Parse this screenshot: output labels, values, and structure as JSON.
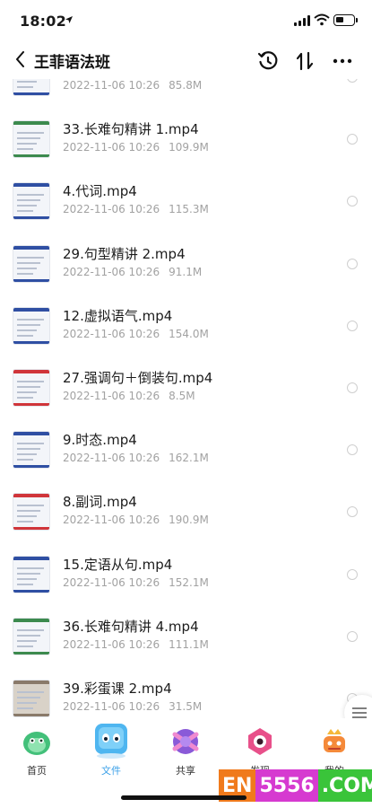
{
  "status_bar": {
    "time": "18:02"
  },
  "header": {
    "title": "王菲语法班"
  },
  "files": [
    {
      "name": "",
      "date": "2022-11-06 10:26",
      "size": "85.8M",
      "thumb": "blue"
    },
    {
      "name": "33.长难句精讲 1.mp4",
      "date": "2022-11-06 10:26",
      "size": "109.9M",
      "thumb": "green"
    },
    {
      "name": "4.代词.mp4",
      "date": "2022-11-06 10:26",
      "size": "115.3M",
      "thumb": "blue"
    },
    {
      "name": "29.句型精讲 2.mp4",
      "date": "2022-11-06 10:26",
      "size": "91.1M",
      "thumb": "blue"
    },
    {
      "name": "12.虚拟语气.mp4",
      "date": "2022-11-06 10:26",
      "size": "154.0M",
      "thumb": "blue"
    },
    {
      "name": "27.强调句＋倒装句.mp4",
      "date": "2022-11-06 10:26",
      "size": "8.5M",
      "thumb": "red"
    },
    {
      "name": "9.时态.mp4",
      "date": "2022-11-06 10:26",
      "size": "162.1M",
      "thumb": "blue"
    },
    {
      "name": "8.副词.mp4",
      "date": "2022-11-06 10:26",
      "size": "190.9M",
      "thumb": "red"
    },
    {
      "name": "15.定语从句.mp4",
      "date": "2022-11-06 10:26",
      "size": "152.1M",
      "thumb": "blue"
    },
    {
      "name": "36.长难句精讲 4.mp4",
      "date": "2022-11-06 10:26",
      "size": "111.1M",
      "thumb": "green"
    },
    {
      "name": "39.彩蛋课 2.mp4",
      "date": "2022-11-06 10:26",
      "size": "31.5M",
      "thumb": "photo"
    }
  ],
  "tabs": [
    {
      "label": "首页",
      "icon": "home-mascot-icon",
      "active": false
    },
    {
      "label": "文件",
      "icon": "files-mascot-icon",
      "active": true
    },
    {
      "label": "共享",
      "icon": "share-mascot-icon",
      "active": false
    },
    {
      "label": "发现",
      "icon": "discover-mascot-icon",
      "active": false
    },
    {
      "label": "我的",
      "icon": "profile-mascot-icon",
      "active": false
    }
  ],
  "watermark": {
    "part1": "EN",
    "part2": "5556",
    "part3": ".COM"
  },
  "colors": {
    "accent": "#3aa0e8",
    "thumb_blue": "#2f4fa3",
    "thumb_green": "#3c8a4e",
    "thumb_red": "#d0353a"
  }
}
